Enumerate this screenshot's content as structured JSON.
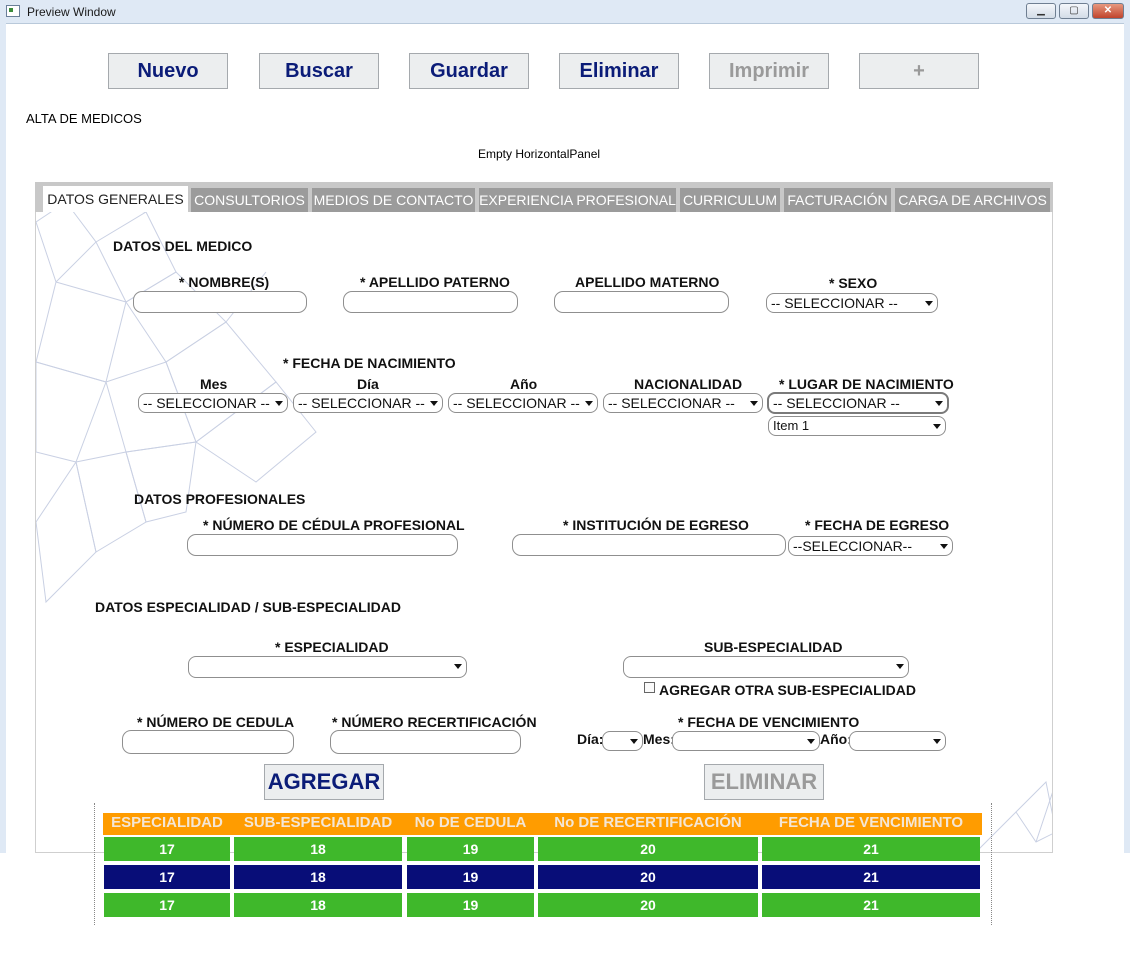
{
  "window": {
    "title": "Preview Window"
  },
  "toolbar": {
    "nuevo": "Nuevo",
    "buscar": "Buscar",
    "guardar": "Guardar",
    "eliminar": "Eliminar",
    "imprimir": "Imprimir",
    "plus": "+"
  },
  "page": {
    "heading": "ALTA DE MEDICOS",
    "empty_panel": "Empty HorizontalPanel"
  },
  "tabs": [
    {
      "label": "DATOS GENERALES"
    },
    {
      "label": "CONSULTORIOS"
    },
    {
      "label": "MEDIOS DE CONTACTO"
    },
    {
      "label": "EXPERIENCIA PROFESIONAL"
    },
    {
      "label": "CURRICULUM"
    },
    {
      "label": "FACTURACIÓN"
    },
    {
      "label": "CARGA DE ARCHIVOS"
    }
  ],
  "datos_medico": {
    "section": "DATOS DEL MEDICO",
    "nombre": "* NOMBRE(S)",
    "apellido_paterno": "* APELLIDO PATERNO",
    "apellido_materno": "APELLIDO MATERNO",
    "sexo": "* SEXO",
    "sexo_value": "-- SELECCIONAR --",
    "fecha_nacimiento": "* FECHA DE NACIMIENTO",
    "mes": "Mes",
    "dia": "Día",
    "anio": "Año",
    "nacionalidad": "NACIONALIDAD",
    "lugar_nacimiento": "* LUGAR DE NACIMIENTO",
    "select_value": "-- SELECCIONAR --",
    "item1": "Item 1"
  },
  "datos_profesionales": {
    "section": "DATOS PROFESIONALES",
    "cedula": "* NÚMERO DE CÉDULA PROFESIONAL",
    "institucion": "* INSTITUCIÓN DE EGRESO",
    "fecha_egreso": "* FECHA DE EGRESO",
    "fecha_egreso_value": "--SELECCIONAR--"
  },
  "especialidad": {
    "section": "DATOS ESPECIALIDAD / SUB-ESPECIALIDAD",
    "especialidad": "* ESPECIALIDAD",
    "sub_especialidad": "SUB-ESPECIALIDAD",
    "agregar_otra": "AGREGAR OTRA SUB-ESPECIALIDAD",
    "num_cedula": "* NÚMERO DE CEDULA",
    "num_recert": "* NÚMERO RECERTIFICACIÓN",
    "fecha_venc": "* FECHA DE VENCIMIENTO",
    "dia": "Día:",
    "mes": "Mes:",
    "anio": "Año:",
    "agregar": "AGREGAR",
    "eliminar": "ELIMINAR"
  },
  "table": {
    "headers": [
      "ESPECIALIDAD",
      "SUB-ESPECIALIDAD",
      "No DE CEDULA",
      "No DE RECERTIFICACIÓN",
      "FECHA DE VENCIMIENTO"
    ],
    "rows": [
      [
        "17",
        "18",
        "19",
        "20",
        "21"
      ],
      [
        "17",
        "18",
        "19",
        "20",
        "21"
      ],
      [
        "17",
        "18",
        "19",
        "20",
        "21"
      ]
    ]
  },
  "colors": {
    "button_text": "#0b1c78",
    "header_orange": "#ff9c00",
    "row_green": "#3fb82b",
    "row_navy": "#080d78",
    "tab_gray": "#9b9b9b"
  }
}
